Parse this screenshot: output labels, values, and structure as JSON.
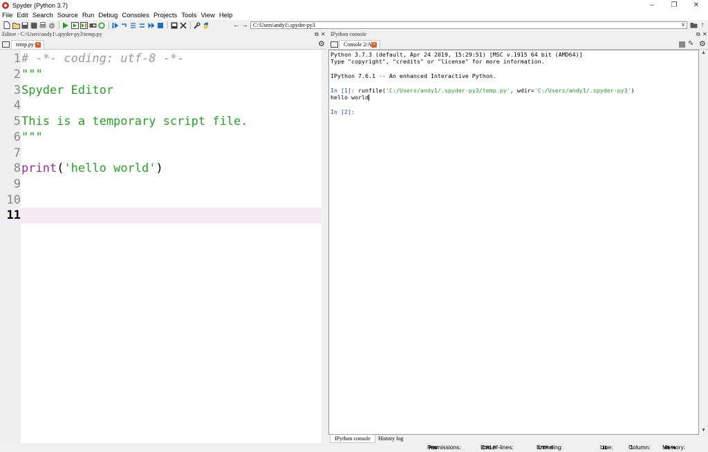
{
  "window": {
    "title": "Spyder (Python 3.7)",
    "minimize": "–",
    "restore": "❐",
    "close": "✕"
  },
  "menu": [
    "File",
    "Edit",
    "Search",
    "Source",
    "Run",
    "Debug",
    "Consoles",
    "Projects",
    "Tools",
    "View",
    "Help"
  ],
  "toolbar": {
    "path": "C:\\Users\\andy1\\.spyder-py3"
  },
  "editor_pane": {
    "title": "Editor - C:\\Users\\andy1\\.spyder-py3\\temp.py",
    "tab_label": "temp.py",
    "lines": [
      {
        "n": "1",
        "text": "# -*- coding: utf-8 -*-",
        "kind": "comment"
      },
      {
        "n": "2",
        "text": "\"\"\"",
        "kind": "string"
      },
      {
        "n": "3",
        "text": "Spyder Editor",
        "kind": "string"
      },
      {
        "n": "4",
        "text": "",
        "kind": "plain"
      },
      {
        "n": "5",
        "text": "This is a temporary script file.",
        "kind": "string"
      },
      {
        "n": "6",
        "text": "\"\"\"",
        "kind": "string"
      },
      {
        "n": "7",
        "text": "",
        "kind": "plain"
      },
      {
        "n": "8",
        "text": "",
        "kind": "print"
      },
      {
        "n": "9",
        "text": "",
        "kind": "plain"
      },
      {
        "n": "10",
        "text": "",
        "kind": "plain"
      },
      {
        "n": "11",
        "text": "",
        "kind": "current"
      }
    ],
    "print_line": {
      "keyword": "print",
      "open": "(",
      "arg": "'hello world'",
      "close": ")"
    }
  },
  "console_pane": {
    "title": "IPython console",
    "tab_label": "Console 2/A",
    "line1": "Python 3.7.3 (default, Apr 24 2019, 15:29:51) [MSC v.1915 64 bit (AMD64)]",
    "line2": "Type \"copyright\", \"credits\" or \"license\" for more information.",
    "line3": "IPython 7.6.1 -- An enhanced Interactive Python.",
    "prompt1": "In [1]:",
    "cmd_pre": " runfile(",
    "cmd_arg1": "'C:/Users/andy1/.spyder-py3/temp.py'",
    "cmd_mid": ", wdir=",
    "cmd_arg2": "'C:/Users/andy1/.spyder-py3'",
    "cmd_end": ")",
    "output": "hello world",
    "prompt2": "In [2]:",
    "bottom_tabs": [
      "IPython console",
      "History log"
    ]
  },
  "status": {
    "permissions_label": "Permissions:",
    "permissions": "RW",
    "eol_label": "End-of-lines:",
    "eol": "CRLF",
    "encoding_label": "Encoding:",
    "encoding": "UTF-8",
    "line_label": "Line:",
    "line": "11",
    "column_label": "Column:",
    "column": "1",
    "memory_label": "Memory:",
    "memory": "45 %"
  },
  "colors": {
    "comment": "#9a9a9a",
    "string": "#2a9d2a",
    "keyword": "#9b2d9b",
    "current_line": "#f6eaf7"
  }
}
